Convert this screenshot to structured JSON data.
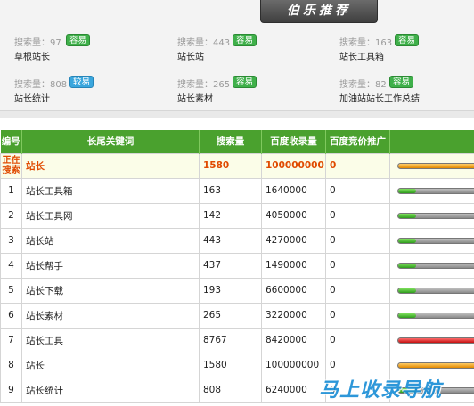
{
  "panel": {
    "title": "伯乐推荐",
    "items": [
      {
        "meta": "搜索量：97",
        "badge": "容易",
        "badge_color": "green",
        "keyword": "草根站长"
      },
      {
        "meta": "搜索量：443",
        "badge": "容易",
        "badge_color": "green",
        "keyword": "站长站"
      },
      {
        "meta": "搜索量：163",
        "badge": "容易",
        "badge_color": "green",
        "keyword": "站长工具箱"
      },
      {
        "meta": "搜索量：808",
        "badge": "较易",
        "badge_color": "blue",
        "keyword": "站长统计"
      },
      {
        "meta": "搜索量：265",
        "badge": "容易",
        "badge_color": "green",
        "keyword": "站长素材"
      },
      {
        "meta": "搜索量：82",
        "badge": "容易",
        "badge_color": "green",
        "keyword": "加油站站长工作总结"
      }
    ]
  },
  "table": {
    "headers": [
      "编号",
      "长尾关键词",
      "搜索量",
      "百度收录量",
      "百度竞价推广",
      ""
    ],
    "rows": [
      {
        "idx": "正在搜索",
        "keyword": "站长",
        "volume": "1580",
        "indexed": "100000000",
        "bid": "0",
        "bar": "orange",
        "level": 1.0
      },
      {
        "idx": "1",
        "keyword": "站长工具箱",
        "volume": "163",
        "indexed": "1640000",
        "bid": "0",
        "bar": "green",
        "level": 0.2
      },
      {
        "idx": "2",
        "keyword": "站长工具网",
        "volume": "142",
        "indexed": "4050000",
        "bid": "0",
        "bar": "green",
        "level": 0.2
      },
      {
        "idx": "3",
        "keyword": "站长站",
        "volume": "443",
        "indexed": "4270000",
        "bid": "0",
        "bar": "green",
        "level": 0.2
      },
      {
        "idx": "4",
        "keyword": "站长帮手",
        "volume": "437",
        "indexed": "1490000",
        "bid": "0",
        "bar": "green",
        "level": 0.2
      },
      {
        "idx": "5",
        "keyword": "站长下载",
        "volume": "193",
        "indexed": "6600000",
        "bid": "0",
        "bar": "green",
        "level": 0.2
      },
      {
        "idx": "6",
        "keyword": "站长素材",
        "volume": "265",
        "indexed": "3220000",
        "bid": "0",
        "bar": "green",
        "level": 0.2
      },
      {
        "idx": "7",
        "keyword": "站长工具",
        "volume": "8767",
        "indexed": "8420000",
        "bid": "0",
        "bar": "red",
        "level": 1.0
      },
      {
        "idx": "8",
        "keyword": "站长",
        "volume": "1580",
        "indexed": "100000000",
        "bid": "0",
        "bar": "orange",
        "level": 1.0
      },
      {
        "idx": "9",
        "keyword": "站长统计",
        "volume": "808",
        "indexed": "6240000",
        "bid": "0",
        "bar": "green",
        "level": 0.2
      }
    ]
  },
  "watermark": "马上收录导航"
}
